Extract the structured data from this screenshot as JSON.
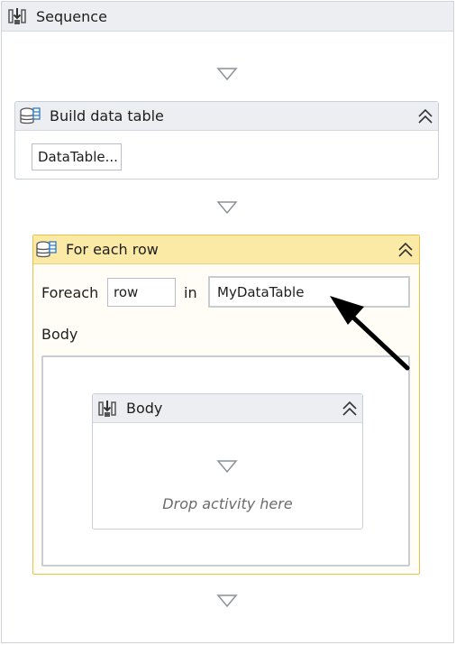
{
  "sequence": {
    "title": "Sequence"
  },
  "build_data_table": {
    "title": "Build data table",
    "button_label": "DataTable..."
  },
  "for_each_row": {
    "title": "For each row",
    "foreach_label": "Foreach",
    "item_value": "row",
    "in_label": "in",
    "collection_value": "MyDataTable",
    "body_label": "Body"
  },
  "body": {
    "title": "Body",
    "drop_hint": "Drop activity here"
  },
  "icons": [
    "sequence-icon",
    "database-icon",
    "chevron-up-double-icon",
    "drop-arrow-icon",
    "annotation-arrow-icon"
  ]
}
